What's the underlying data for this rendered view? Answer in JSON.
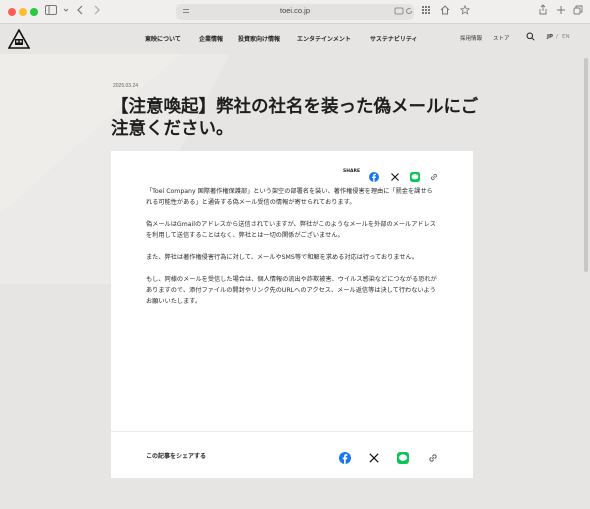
{
  "browser": {
    "url": "toei.co.jp",
    "icons": [
      "sidebar-icon",
      "back-icon",
      "forward-icon",
      "translate-icon",
      "refresh-icon",
      "grid-icon",
      "home-icon",
      "star-icon",
      "share-icon",
      "new-tab-icon",
      "tabs-icon"
    ]
  },
  "header": {
    "nav": [
      "東映について",
      "企業情報",
      "投資家向け情報",
      "エンタテインメント",
      "サステナビリティ"
    ],
    "recruit": "採用情報",
    "store": "ストア",
    "lang_jp": "JP",
    "lang_sep": "/",
    "lang_en": "EN"
  },
  "article": {
    "date": "2025.03.24",
    "title": "【注意喚起】弊社の社名を装った偽メールにご注意ください。",
    "share_label": "SHARE",
    "paragraphs": [
      "「Toei Company 国際著作権保護部」という架空の部署名を装い、著作権侵害を理由に「罰金を課せられる可能性がある」と通告する偽メール受信の情報が寄せられております。",
      "偽メールはGmailのアドレスから送信されていますが、弊社がこのようなメールを外部のメールアドレスを利用して送信することはなく、弊社とは一切の関係がございません。",
      "また、弊社は著作権侵害行為に対して、メールやSMS等で和解を求める対応は行っておりません。",
      "もし、同様のメールを受信した場合は、個人情報の流出や詐欺被害、ウイルス感染などにつながる恐れがありますので、添付ファイルの開封やリンク先のURLへのアクセス、メール返信等は決して行わないようお願いいたします。"
    ],
    "share_bottom_label": "この記事をシェアする"
  },
  "colors": {
    "facebook": "#1877f2",
    "line": "#06c755",
    "x": "#111111",
    "link": "#666666"
  }
}
